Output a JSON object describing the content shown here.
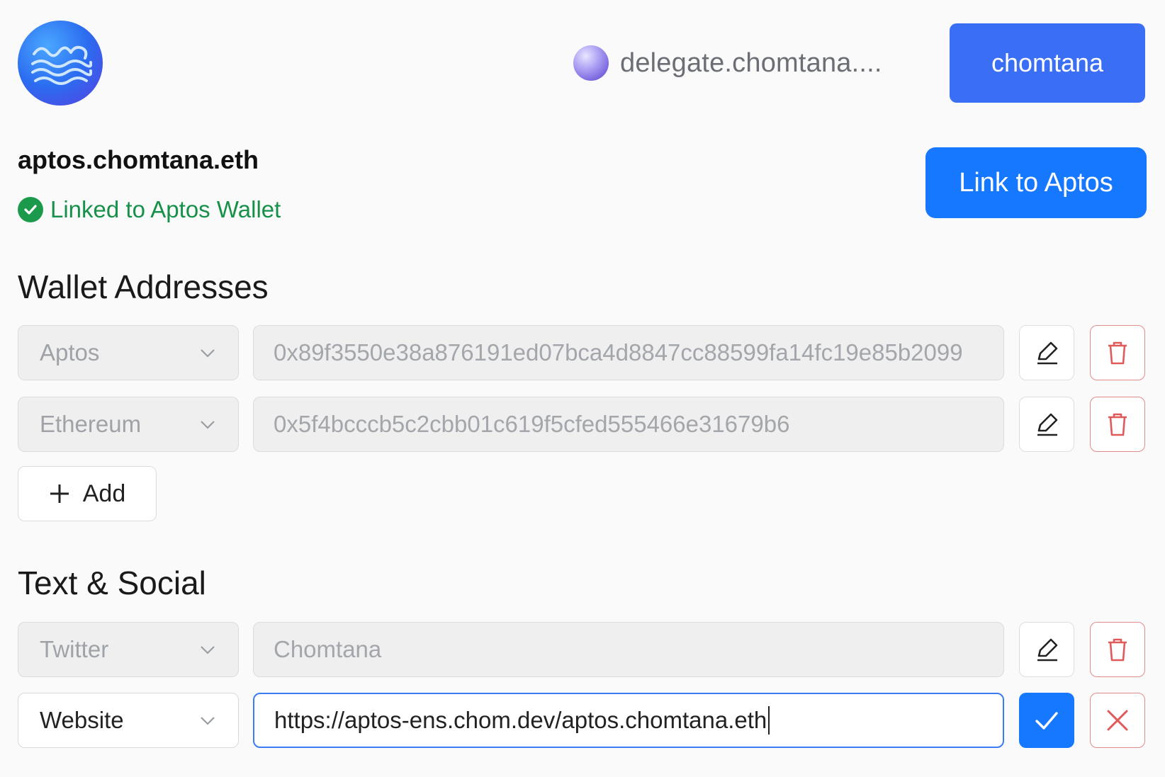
{
  "header": {
    "logo_icon": "waves-icon",
    "delegate_label": "delegate.chomtana....",
    "user_button": "chomtana"
  },
  "profile": {
    "name": "aptos.chomtana.eth",
    "linked_status": "Linked to Aptos Wallet",
    "link_button": "Link to Aptos"
  },
  "wallets": {
    "title": "Wallet Addresses",
    "rows": [
      {
        "chain": "Aptos",
        "address": "0x89f3550e38a876191ed07bca4d8847cc88599fa14fc19e85b2099"
      },
      {
        "chain": "Ethereum",
        "address": "0x5f4bcccb5c2cbb01c619f5cfed555466e31679b6"
      }
    ],
    "add_label": "Add"
  },
  "social": {
    "title": "Text & Social",
    "rows": [
      {
        "type": "Twitter",
        "value": "Chomtana"
      },
      {
        "type": "Website",
        "value": "https://aptos-ens.chom.dev/aptos.chomtana.eth"
      }
    ]
  },
  "colors": {
    "primary": "#1677ff",
    "user_button": "#3a6ff5",
    "success": "#17914a",
    "danger": "#e05a5a"
  }
}
